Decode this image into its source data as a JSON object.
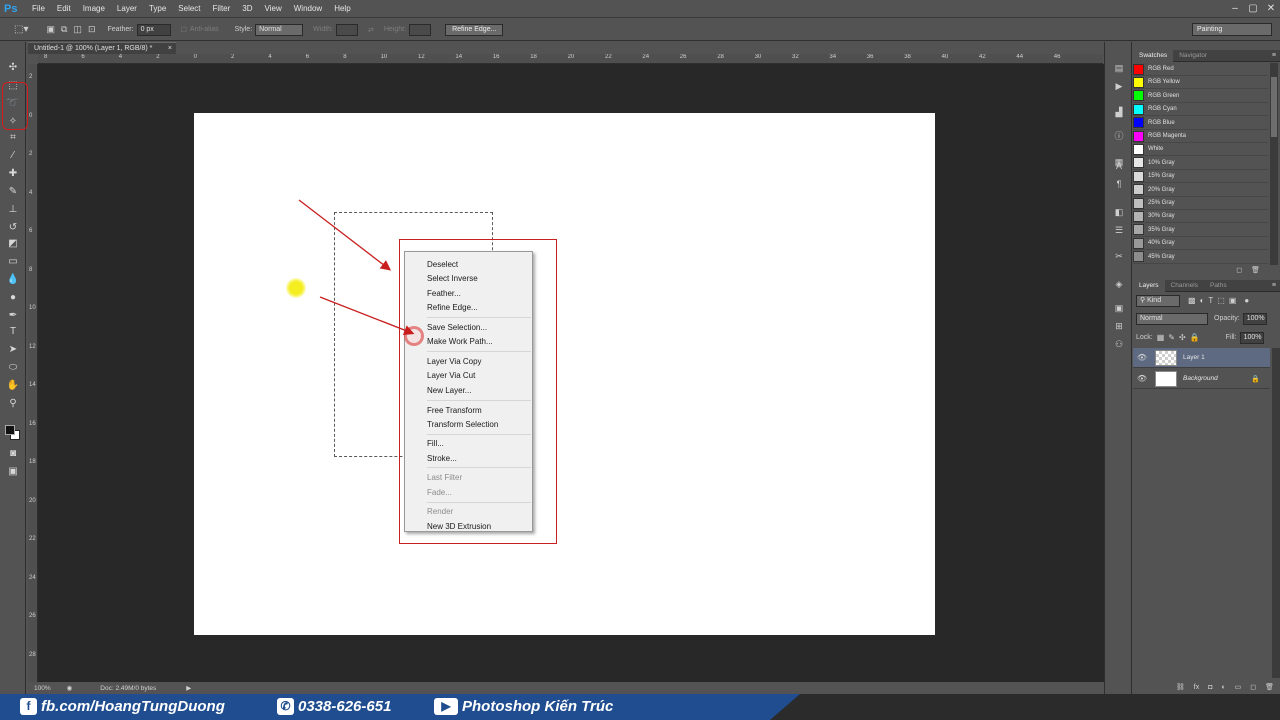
{
  "app": {
    "logo": "Ps"
  },
  "menu": [
    "File",
    "Edit",
    "Image",
    "Layer",
    "Type",
    "Select",
    "Filter",
    "3D",
    "View",
    "Window",
    "Help"
  ],
  "options_bar": {
    "feather_label": "Feather:",
    "feather_value": "0 px",
    "antialias_label": "Anti-alias",
    "style_label": "Style:",
    "style_value": "Normal",
    "width_label": "Width:",
    "height_label": "Height:",
    "refine_edge": "Refine Edge...",
    "workspace": "Painting"
  },
  "document": {
    "tab_title": "Untitled-1 @ 100% (Layer 1, RGB/8) *",
    "zoom": "100%",
    "doc_info": "Doc: 2.49M/0 bytes"
  },
  "rulers": {
    "top": [
      "8",
      "6",
      "4",
      "2",
      "0",
      "2",
      "4",
      "6",
      "8",
      "10",
      "12",
      "14",
      "16",
      "18",
      "20",
      "22",
      "24",
      "26",
      "28",
      "30",
      "32",
      "34",
      "36",
      "38",
      "40",
      "42",
      "44",
      "46"
    ],
    "left": [
      "2",
      "0",
      "2",
      "4",
      "6",
      "8",
      "10",
      "12",
      "14",
      "16",
      "18",
      "20",
      "22",
      "24",
      "26",
      "28"
    ]
  },
  "context_menu": {
    "items": [
      {
        "label": "Deselect",
        "enabled": true
      },
      {
        "label": "Select Inverse",
        "enabled": true
      },
      {
        "label": "Feather...",
        "enabled": true
      },
      {
        "label": "Refine Edge...",
        "enabled": true
      },
      {
        "label": "Save Selection...",
        "enabled": true
      },
      {
        "label": "Make Work Path...",
        "enabled": true
      },
      {
        "label": "Layer Via Copy",
        "enabled": true
      },
      {
        "label": "Layer Via Cut",
        "enabled": true
      },
      {
        "label": "New Layer...",
        "enabled": true
      },
      {
        "label": "Free Transform",
        "enabled": true
      },
      {
        "label": "Transform Selection",
        "enabled": true
      },
      {
        "label": "Fill...",
        "enabled": true
      },
      {
        "label": "Stroke...",
        "enabled": true
      },
      {
        "label": "Last Filter",
        "enabled": false
      },
      {
        "label": "Fade...",
        "enabled": false
      },
      {
        "label": "Render",
        "enabled": false
      },
      {
        "label": "New 3D Extrusion",
        "enabled": true
      }
    ]
  },
  "swatches_panel": {
    "tabs": [
      "Swatches",
      "Navigator"
    ],
    "items": [
      {
        "name": "RGB Red",
        "color": "#ff0000"
      },
      {
        "name": "RGB Yellow",
        "color": "#ffff00"
      },
      {
        "name": "RGB Green",
        "color": "#00ff00"
      },
      {
        "name": "RGB Cyan",
        "color": "#00ffff"
      },
      {
        "name": "RGB Blue",
        "color": "#0000ff"
      },
      {
        "name": "RGB Magenta",
        "color": "#ff00ff"
      },
      {
        "name": "White",
        "color": "#ffffff"
      },
      {
        "name": "10% Gray",
        "color": "#e6e6e6"
      },
      {
        "name": "15% Gray",
        "color": "#d9d9d9"
      },
      {
        "name": "20% Gray",
        "color": "#cccccc"
      },
      {
        "name": "25% Gray",
        "color": "#bfbfbf"
      },
      {
        "name": "30% Gray",
        "color": "#b3b3b3"
      },
      {
        "name": "35% Gray",
        "color": "#a6a6a6"
      },
      {
        "name": "40% Gray",
        "color": "#999999"
      },
      {
        "name": "45% Gray",
        "color": "#8c8c8c"
      }
    ]
  },
  "layers_panel": {
    "tabs": [
      "Layers",
      "Channels",
      "Paths"
    ],
    "kind": "Kind",
    "blend_mode": "Normal",
    "opacity_label": "Opacity:",
    "opacity_value": "100%",
    "lock_label": "Lock:",
    "fill_label": "Fill:",
    "fill_value": "100%",
    "layers": [
      {
        "name": "Layer 1",
        "selected": true
      },
      {
        "name": "Background",
        "selected": false
      }
    ]
  },
  "footer": {
    "facebook": "fb.com/HoangTungDuong",
    "phone": "0338-626-651",
    "youtube": "Photoshop Kiến Trúc"
  }
}
